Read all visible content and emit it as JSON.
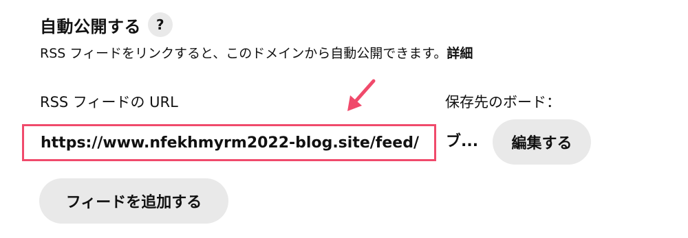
{
  "auto_publish": {
    "title": "自動公開する",
    "help_icon_label": "?",
    "description": "RSS フィードをリンクすると、このドメインから自動公開できます。",
    "detail_link": "詳細"
  },
  "feed": {
    "rss_url_label": "RSS フィードの URL",
    "rss_url_value": "https://www.nfekhmyrm2022-blog.site/feed/",
    "board_label": "保存先のボード：",
    "board_value": "ブ...",
    "edit_button": "編集する",
    "add_feed_button": "フィードを追加する"
  },
  "annotation": {
    "highlight_color": "#f04a6b",
    "arrow_icon": "arrow-down-left-icon"
  }
}
